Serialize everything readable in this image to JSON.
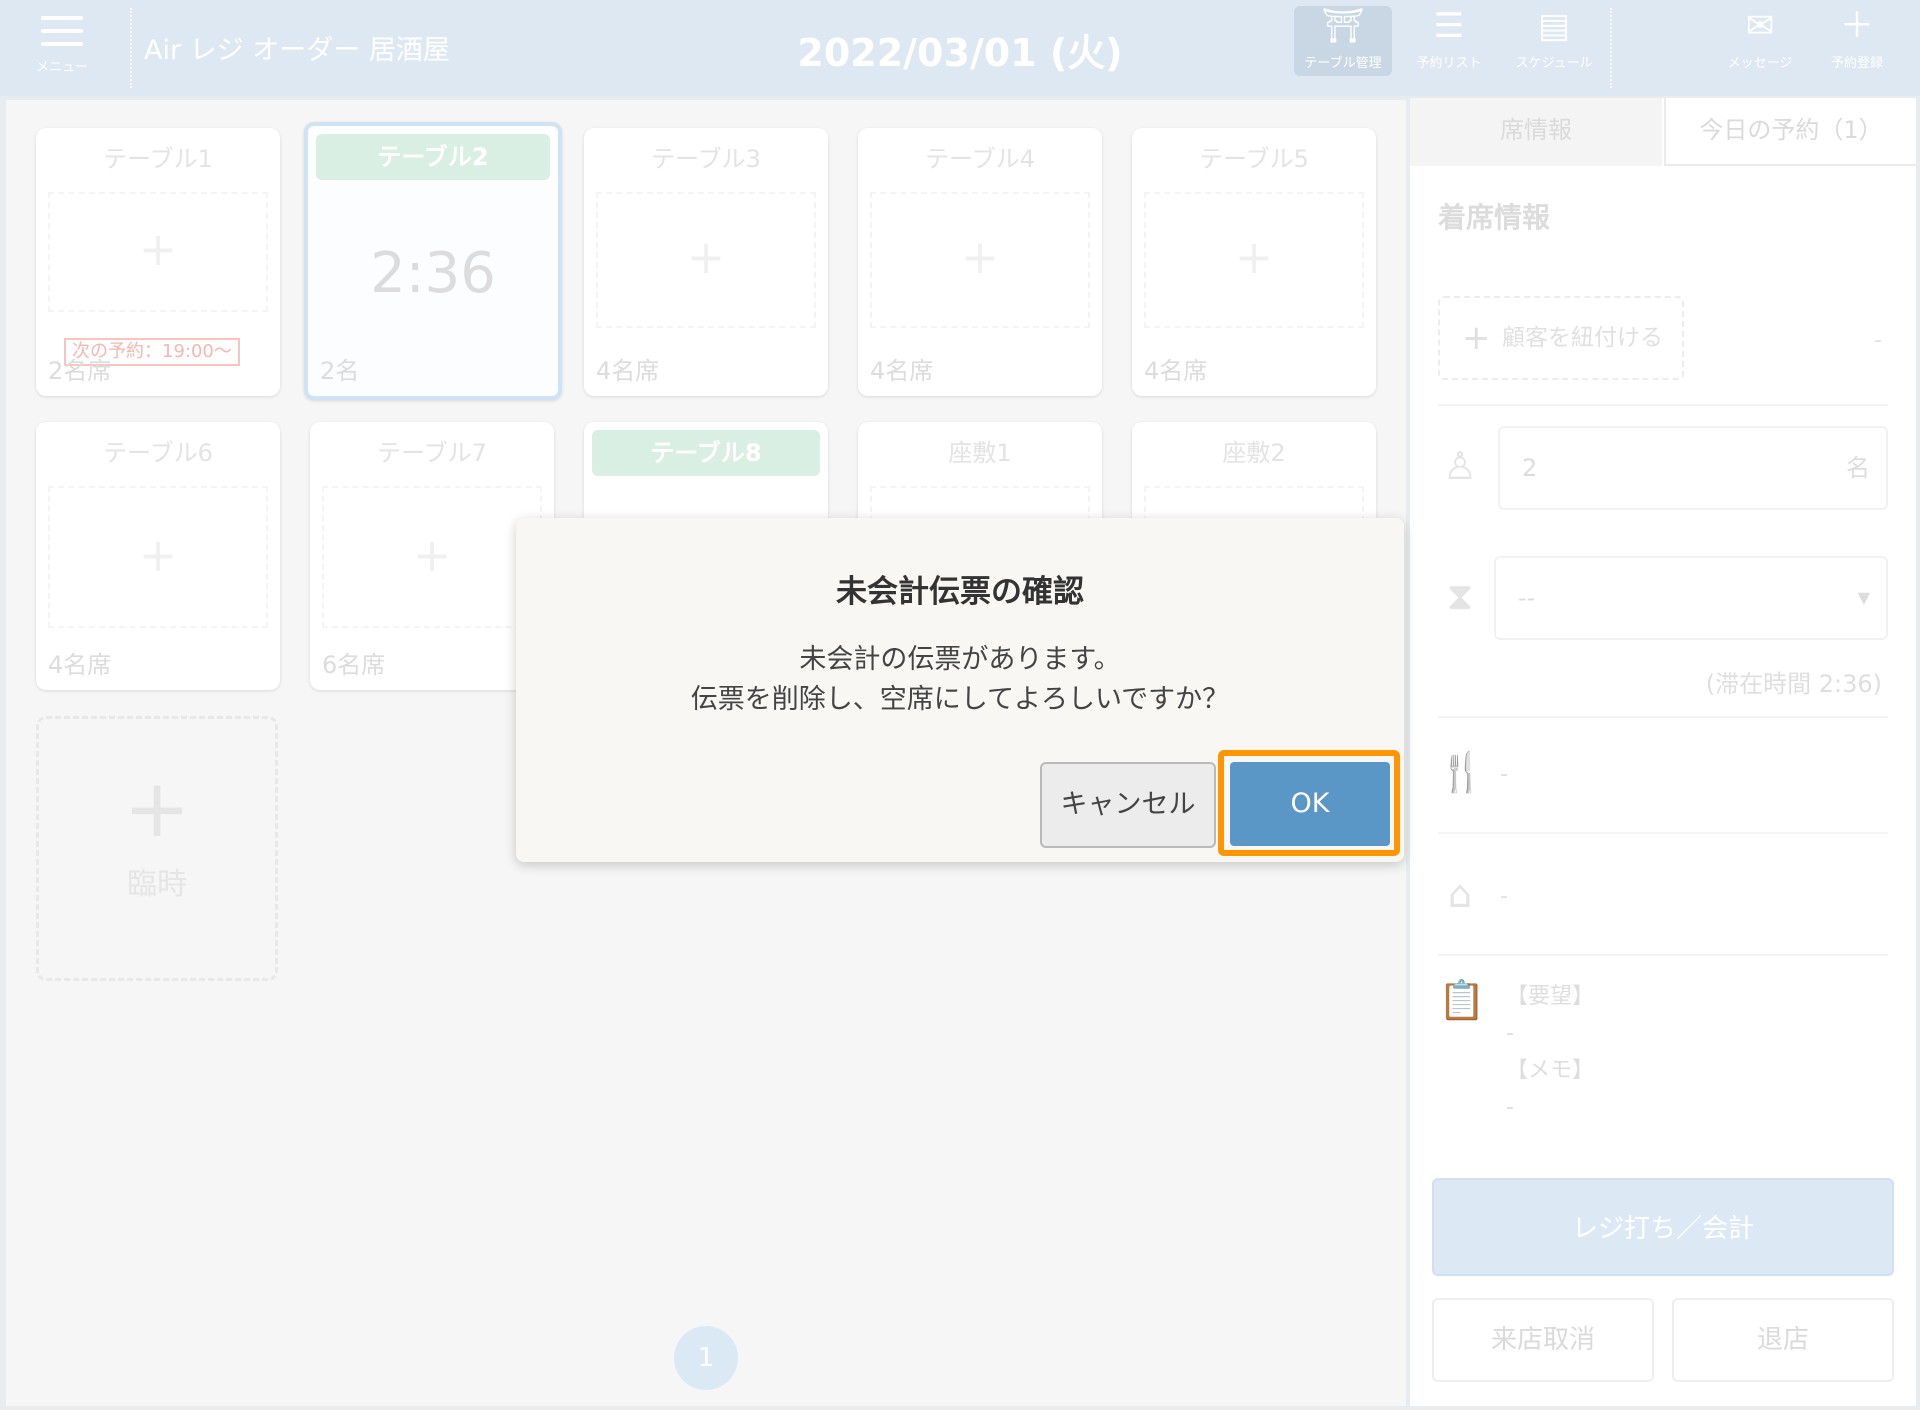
{
  "header": {
    "menu_label": "メニュー",
    "app_title": "Air レジ オーダー 居酒屋",
    "date": "2022/03/01 (火)",
    "buttons": [
      {
        "label": "テーブル管理",
        "icon": "table-icon"
      },
      {
        "label": "予約リスト",
        "icon": "list-icon"
      },
      {
        "label": "スケジュール",
        "icon": "schedule-icon"
      },
      {
        "label": "メッセージ",
        "icon": "mail-icon"
      },
      {
        "label": "予約登録",
        "icon": "plus-icon"
      }
    ]
  },
  "tables": [
    {
      "name": "テーブル1",
      "capacity": "2名席",
      "next_reservation": "次の予約：19:00〜"
    },
    {
      "name": "テーブル2",
      "capacity": "2名",
      "timer": "2:36",
      "occupied": true,
      "selected": true
    },
    {
      "name": "テーブル3",
      "capacity": "4名席"
    },
    {
      "name": "テーブル4",
      "capacity": "4名席"
    },
    {
      "name": "テーブル5",
      "capacity": "4名席"
    },
    {
      "name": "テーブル6",
      "capacity": "4名席"
    },
    {
      "name": "テーブル7",
      "capacity": "6名席"
    },
    {
      "name": "テーブル8",
      "occupied": true
    },
    {
      "name": "座敷1"
    },
    {
      "name": "座敷2"
    }
  ],
  "temp_seat": {
    "plus": "+",
    "label": "臨時"
  },
  "pagination": {
    "current": "1"
  },
  "side": {
    "tabs": [
      "席情報",
      "今日の予約（1）"
    ],
    "section_title": "着席情報",
    "link_customer": "顧客を紐付ける",
    "link_customer_value": "-",
    "guests": "2",
    "guests_unit": "名",
    "duration_select": "--",
    "stay_time": "(滞在時間 2:36)",
    "course": "-",
    "tag": "-",
    "request_label": "【要望】",
    "request_value": "-",
    "memo_label": "【メモ】",
    "memo_value": "-",
    "register_button": "レジ打ち／会計",
    "cancel_visit_button": "来店取消",
    "leave_button": "退店"
  },
  "dialog": {
    "title": "未会計伝票の確認",
    "message_line1": "未会計の伝票があります。",
    "message_line2": "伝票を削除し、空席にしてよろしいですか？",
    "cancel_label": "キャンセル",
    "ok_label": "OK",
    "highlight_color": "#ff9500"
  }
}
